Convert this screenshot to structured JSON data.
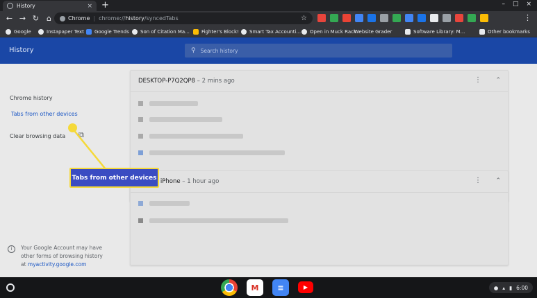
{
  "tab": {
    "title": "History",
    "close": "×",
    "new": "+"
  },
  "window_controls": [
    "–",
    "□",
    "×"
  ],
  "toolbar": {
    "back": "←",
    "forward": "→",
    "reload": "↻",
    "home": "⌂",
    "menu": "⋮"
  },
  "omnibox": {
    "label": "Chrome",
    "url_prefix": "chrome://",
    "url_host": "history",
    "url_path": "/syncedTabs",
    "star": "☆"
  },
  "extensions": [
    "#e8453c",
    "#34a853",
    "#ea4335",
    "#4285f4",
    "#1a73e8",
    "#9aa0a6",
    "#34a853",
    "#4285f4",
    "#1a73e8",
    "#e8eaed",
    "#9aa0a6",
    "#e8453c",
    "#34a853",
    "#fbbc05"
  ],
  "bookmarks": [
    {
      "label": "Google",
      "color": "#e8eaed"
    },
    {
      "label": "Instapaper Text",
      "color": "#e8eaed"
    },
    {
      "label": "Google Trends",
      "color": "#4285f4"
    },
    {
      "label": "Son of Citation Ma...",
      "color": "#e8eaed"
    },
    {
      "label": "Fighter's Block!",
      "color": "#fbbc05"
    },
    {
      "label": "Smart Tax Accounti...",
      "color": "#e8eaed"
    },
    {
      "label": "Open in Muck Rack",
      "color": "#e8eaed"
    },
    {
      "label": "Website Grader",
      "color": "#e8eaed"
    },
    {
      "label": "Software Library: M...",
      "color": "#e8eaed"
    },
    {
      "label": "Other bookmarks",
      "color": "#e8eaed"
    }
  ],
  "header": {
    "title": "History",
    "search_placeholder": "Search history"
  },
  "sidebar": {
    "items": [
      "Chrome history",
      "Tabs from other devices",
      "Clear browsing data"
    ],
    "footer": {
      "text": "Your Google Account may have other forms of browsing history at ",
      "link": "myactivity.google.com"
    }
  },
  "devices": [
    {
      "name": "DESKTOP-P7Q2QP8",
      "time": " – 2 mins ago"
    },
    {
      "name": "Gabe's iPhone",
      "time": " – 1 hour ago"
    }
  ],
  "callout": {
    "text": "Tabs from other devices"
  },
  "shelf": {
    "time": "6:00"
  }
}
